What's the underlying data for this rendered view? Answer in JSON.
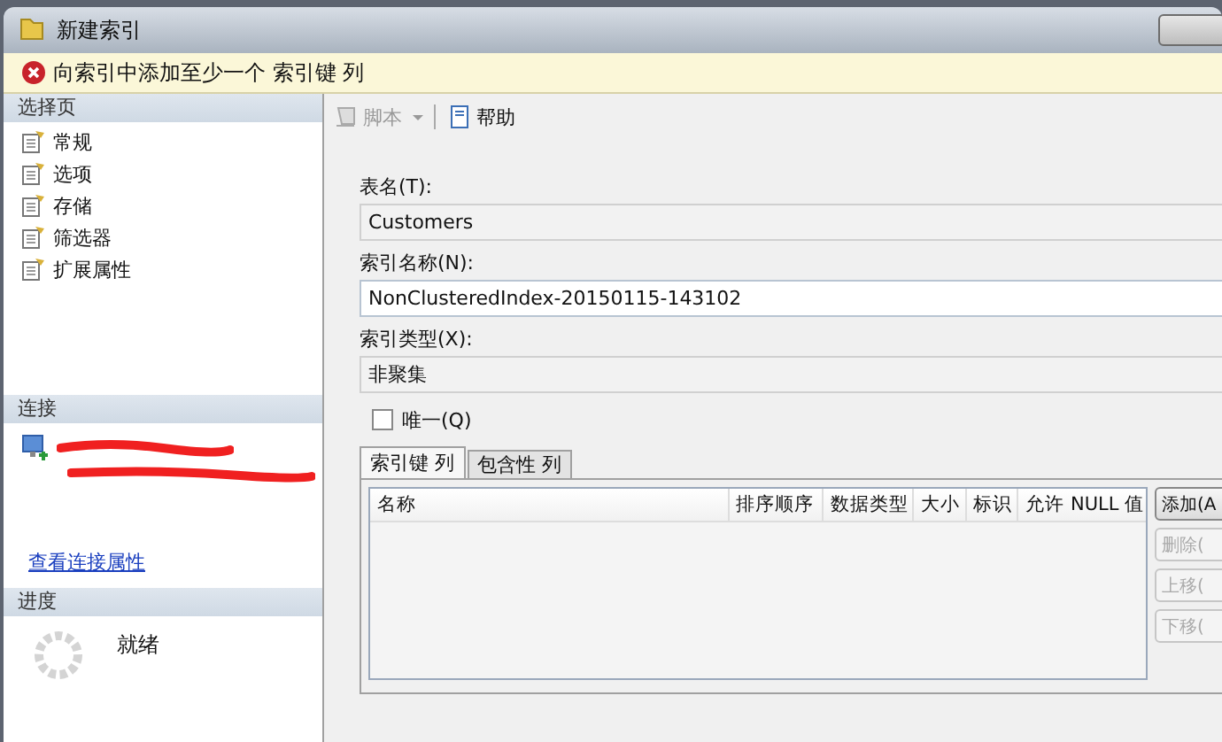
{
  "window": {
    "title": "新建索引"
  },
  "error_bar": {
    "message": "向索引中添加至少一个 索引键 列"
  },
  "sidebar": {
    "header": "选择页",
    "items": [
      {
        "label": "常规",
        "selected": false
      },
      {
        "label": "选项",
        "selected": false
      },
      {
        "label": "存储",
        "selected": false
      },
      {
        "label": "筛选器",
        "selected": false
      },
      {
        "label": "扩展属性",
        "selected": false
      }
    ]
  },
  "connection": {
    "header": "连接",
    "link": "查看连接属性"
  },
  "progress": {
    "header": "进度",
    "status": "就绪"
  },
  "toolbar": [
    {
      "label": "脚本",
      "kind": "script",
      "disabled": true
    },
    {
      "label": "帮助",
      "kind": "help",
      "disabled": false
    }
  ],
  "form": {
    "fields": [
      {
        "label": "表名(T):",
        "value": "Customers",
        "disabled": true
      },
      {
        "label": "索引名称(N):",
        "value": "NonClusteredIndex-20150115-143102",
        "disabled": false
      },
      {
        "label": "索引类型(X):",
        "value": "非聚集",
        "disabled": true
      }
    ],
    "unique": {
      "label": "唯一(Q)",
      "checked": false
    }
  },
  "tabs": [
    {
      "label": "索引键 列",
      "selected": true
    },
    {
      "label": "包含性 列",
      "selected": false
    }
  ],
  "table": {
    "columns": [
      "名称",
      "排序顺序",
      "数据类型",
      "大小",
      "标识",
      "允许 NULL 值"
    ]
  },
  "buttons": [
    {
      "label": "添加(A",
      "disabled": false
    },
    {
      "label": "删除(",
      "disabled": true
    },
    {
      "label": "上移(",
      "disabled": true
    },
    {
      "label": "下移(",
      "disabled": true
    }
  ]
}
